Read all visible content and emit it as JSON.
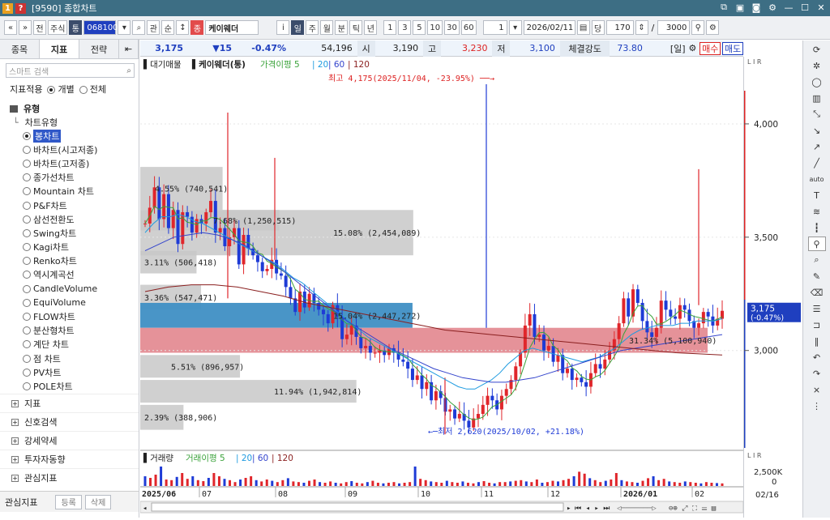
{
  "window": {
    "title": "[9590] 종합차트",
    "icon_q": "?",
    "icon_no": "1"
  },
  "toolbar": {
    "nav1": "«",
    "nav2": "»",
    "market": "전",
    "type": "주식",
    "kind": "통",
    "code": "068100",
    "q_search": "관",
    "q_sort": "순",
    "q_sep": "↕",
    "tag": "종",
    "name": "케이웨더",
    "info": "i",
    "periods": [
      "일",
      "주",
      "월",
      "분",
      "틱",
      "년"
    ],
    "numbers": [
      "1",
      "3",
      "5",
      "10",
      "30",
      "60"
    ],
    "count1": "1",
    "date": "2026/02/11",
    "dang": "당",
    "n1": "170",
    "slash": "/",
    "n2": "3000"
  },
  "left": {
    "tabs": [
      "종목",
      "지표",
      "전략"
    ],
    "search_placeholder": "스마트 검색",
    "apply_label": "지표적용",
    "opt1": "개별",
    "opt2": "전체",
    "group_type": "유형",
    "chart_type": "차트유형",
    "items": [
      "봉차트",
      "바차트(시고저종)",
      "바차트(고저종)",
      "종가선차트",
      "Mountain 차트",
      "P&F차트",
      "삼선전환도",
      "Swing차트",
      "Kagi차트",
      "Renko차트",
      "역시계곡선",
      "CandleVolume",
      "EquiVolume",
      "FLOW차트",
      "분산형차트",
      "계단 차트",
      "점 차트",
      "PV차트",
      "POLE차트"
    ],
    "groups": [
      "지표",
      "신호검색",
      "강세약세",
      "투자자동향",
      "관심지표"
    ],
    "bottom_label": "관심지표",
    "btn_add": "등록",
    "btn_del": "삭제"
  },
  "quote": {
    "price": "3,175",
    "change": "▼15",
    "rate": "-0.47%",
    "volume": "54,196",
    "open_label": "시",
    "open": "3,190",
    "high_label": "고",
    "high": "3,230",
    "low_label": "저",
    "low": "3,100",
    "strength_label": "체결강도",
    "strength": "73.80",
    "period": "[일]",
    "buy": "매수",
    "sell": "매도"
  },
  "legend": {
    "tag": "대기매물",
    "name": "케이웨더(통)",
    "ma_label": "가격이평",
    "ma_periods": [
      "5",
      "20",
      "60",
      "120"
    ],
    "ma_colors": [
      "#3aa23a",
      "#1e9be0",
      "#3344cc",
      "#8a1f1f"
    ]
  },
  "volume_legend": {
    "tag": "거래량",
    "ma_label": "거래이평",
    "ma_periods": [
      "5",
      "20",
      "60",
      "120"
    ]
  },
  "annotations": {
    "high": "최고 4,175(2025/11/04, -23.95%)",
    "low": "최저 2,620(2025/10/02, +21.18%)",
    "price_tag": "3,175",
    "price_tag_rate": "(-0.47%)",
    "vol_axis": "2,500K",
    "vol_axis2": "0",
    "last_date": "02/16",
    "lir": "L I R"
  },
  "chart_data": {
    "type": "candlestick",
    "price_axis": {
      "ticks": [
        3000,
        3500,
        4000
      ],
      "labels": [
        "3,000",
        "3,500",
        "4,000"
      ],
      "ymin": 2570,
      "ymax": 4250
    },
    "x_labels": [
      "2025/06",
      "07",
      "08",
      "09",
      "10",
      "11",
      "12",
      "2026/01",
      "02"
    ],
    "volume_profile": [
      {
        "label": "4.55% (740,541)",
        "price_lo": 3620,
        "price_hi": 3810,
        "fraction": 0.0455,
        "color": "#c8c8c8"
      },
      {
        "label": "15.08% (2,454,089)",
        "price_lo": 3420,
        "price_hi": 3620,
        "fraction": 0.1508,
        "color": "#c8c8c8"
      },
      {
        "label": "7.68% (1,250,515)",
        "price_lo": 3530,
        "price_hi": 3620,
        "fraction": 0.0768,
        "color": "#c8c8c8"
      },
      {
        "label": "3.11% (506,418)",
        "price_lo": 3340,
        "price_hi": 3440,
        "fraction": 0.0311,
        "color": "#c8c8c8"
      },
      {
        "label": "3.36% (547,471)",
        "price_lo": 3180,
        "price_hi": 3290,
        "fraction": 0.0336,
        "color": "#c8c8c8"
      },
      {
        "label": "15.04% (2,447,272)",
        "price_lo": 3100,
        "price_hi": 3210,
        "fraction": 0.1504,
        "color": "#3f8fc4"
      },
      {
        "label": "31.34% (5,100,940)",
        "price_lo": 2990,
        "price_hi": 3100,
        "fraction": 0.3134,
        "color": "#e48c93"
      },
      {
        "label": "5.51% (896,957)",
        "price_lo": 2880,
        "price_hi": 2980,
        "fraction": 0.0551,
        "color": "#c8c8c8"
      },
      {
        "label": "11.94% (1,942,814)",
        "price_lo": 2770,
        "price_hi": 2870,
        "fraction": 0.1194,
        "color": "#c8c8c8"
      },
      {
        "label": "2.39% (388,906)",
        "price_lo": 2650,
        "price_hi": 2760,
        "fraction": 0.0239,
        "color": "#c8c8c8"
      }
    ],
    "close_series": [
      3560,
      3630,
      3720,
      3580,
      3690,
      3540,
      3620,
      3470,
      3610,
      3590,
      3520,
      3580,
      3560,
      3610,
      3660,
      3520,
      3540,
      3460,
      3500,
      3540,
      3380,
      3510,
      3450,
      3420,
      3390,
      3350,
      3360,
      3400,
      3340,
      3330,
      3280,
      3230,
      3170,
      3260,
      3190,
      3250,
      3210,
      3180,
      3160,
      3120,
      3200,
      3150,
      3050,
      3070,
      3110,
      3060,
      3010,
      3020,
      2990,
      2990,
      3000,
      2980,
      3010,
      2990,
      2960,
      2950,
      2920,
      2870,
      2890,
      2830,
      2860,
      2780,
      2820,
      2790,
      2730,
      2740,
      2700,
      2720,
      2690,
      2660,
      2700,
      2720,
      2760,
      2800,
      2780,
      2740,
      2800,
      2830,
      2870,
      2930,
      2990,
      3110,
      3160,
      3060,
      3070,
      3000,
      3020,
      2950,
      2980,
      2900,
      2920,
      2870,
      2880,
      2860,
      2840,
      2900,
      2940,
      2920,
      2960,
      3000,
      3050,
      3120,
      3230,
      3150,
      3270,
      3210,
      3130,
      3080,
      3060,
      3100,
      3220,
      3180,
      3150,
      3140,
      3200,
      3180,
      3130,
      3100,
      3120,
      3170,
      3150,
      3110,
      3140,
      3175
    ],
    "ma20": [
      3520,
      3560,
      3590,
      3590,
      3600,
      3590,
      3570,
      3560,
      3540,
      3520,
      3500,
      3480,
      3460,
      3440,
      3420,
      3400,
      3380,
      3350,
      3320,
      3300,
      3270,
      3240,
      3210,
      3180,
      3150,
      3120,
      3090,
      3060,
      3040,
      3020,
      3000,
      2980,
      2960,
      2940,
      2920,
      2900,
      2880,
      2860,
      2840,
      2830,
      2830,
      2850,
      2870,
      2900,
      2940,
      2970,
      3000,
      3010,
      3000,
      2990,
      2980,
      2970,
      2960,
      2950,
      2960,
      2970,
      2990,
      3010,
      3040,
      3070,
      3090,
      3100,
      3110,
      3110,
      3110,
      3120,
      3120,
      3130,
      3130,
      3130,
      3140
    ],
    "ma60": [
      3440,
      3470,
      3500,
      3510,
      3520,
      3510,
      3490,
      3460,
      3420,
      3380,
      3330,
      3280,
      3230,
      3180,
      3130,
      3090,
      3050,
      3010,
      2980,
      2950,
      2920,
      2900,
      2880,
      2870,
      2860,
      2860,
      2870,
      2880,
      2900,
      2920,
      2940,
      2960,
      2980,
      3000,
      3010,
      3020,
      3030,
      3040,
      3050,
      3060,
      3070
    ],
    "ma120": [
      3260,
      3280,
      3290,
      3290,
      3280,
      3260,
      3240,
      3210,
      3190,
      3170,
      3150,
      3130,
      3110,
      3090,
      3080,
      3070,
      3060,
      3050,
      3040,
      3030,
      3020,
      3010,
      3000,
      2990,
      2985,
      2980
    ],
    "volume": [
      30,
      25,
      35,
      60,
      20,
      18,
      28,
      40,
      22,
      30,
      18,
      15,
      25,
      40,
      30,
      22,
      18,
      12,
      20,
      25,
      30,
      18,
      14,
      20,
      16,
      12,
      18,
      24,
      14,
      12,
      10,
      16,
      20,
      12,
      10,
      14,
      10,
      8,
      12,
      15,
      10,
      8,
      12,
      16,
      10,
      8,
      10,
      12,
      8,
      10,
      12,
      60,
      22,
      18,
      14,
      12,
      10,
      16,
      12,
      10,
      14,
      10,
      8,
      12,
      15,
      10,
      8,
      12,
      12,
      14,
      16,
      18,
      14,
      12,
      20,
      10,
      12,
      16,
      14,
      18,
      22,
      30,
      44,
      38,
      24,
      18,
      12,
      16,
      20,
      40,
      18,
      14,
      12,
      10,
      16,
      24,
      30,
      18,
      22,
      14,
      12,
      10,
      14,
      12,
      10,
      8,
      12,
      10,
      9,
      8
    ]
  }
}
